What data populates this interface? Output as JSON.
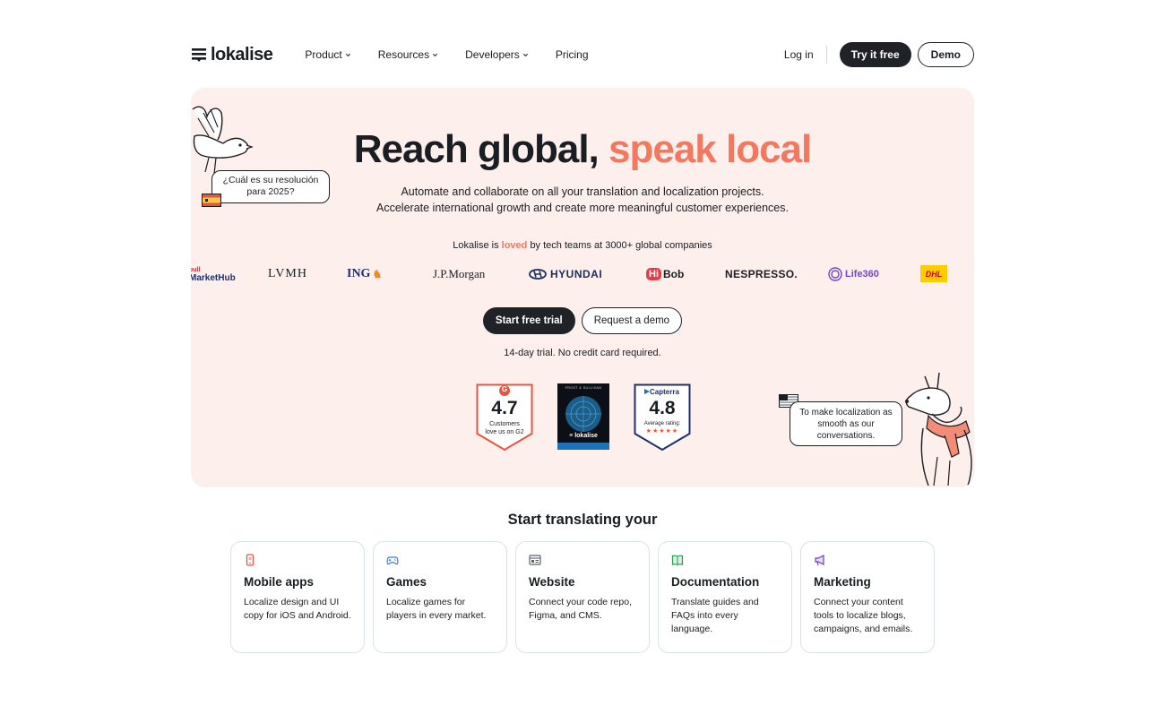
{
  "header": {
    "logo_text": "lokalise",
    "nav": [
      {
        "label": "Product",
        "has_dropdown": true
      },
      {
        "label": "Resources",
        "has_dropdown": true
      },
      {
        "label": "Developers",
        "has_dropdown": true
      },
      {
        "label": "Pricing",
        "has_dropdown": false
      }
    ],
    "login_label": "Log in",
    "try_label": "Try it free",
    "demo_label": "Demo"
  },
  "hero": {
    "title_main": "Reach global,",
    "title_accent": "speak local",
    "subtitle_line1": "Automate and collaborate on all your translation and localization projects.",
    "subtitle_line2": "Accelerate international growth and create more meaningful customer experiences.",
    "loved_prefix": "Lokalise is",
    "loved_word": "loved",
    "loved_suffix": "by tech teams at 3000+ global companies",
    "brands": {
      "marketHub": "MarketHub",
      "marketHub_top": "bull",
      "lvmh": "LVMH",
      "ing": "ING",
      "jpmorgan": "J.P.Morgan",
      "hyundai": "HYUNDAI",
      "hibob_hi": "Hi",
      "hibob_bob": "Bob",
      "nespresso": "NESPRESSO.",
      "life360": "Life360",
      "dhl": "DHL"
    },
    "cta_primary": "Start free trial",
    "cta_secondary": "Request a demo",
    "trial_note": "14-day trial. No credit card required.",
    "bubble_left": "¿Cuál es su resolución para 2025?",
    "bubble_right": "To make localization as smooth as our conversations."
  },
  "badges": {
    "g2": {
      "rating": "4.7",
      "caption": "Customers love us on G2",
      "letter": "G"
    },
    "frost": {
      "top": "FROST & SULLIVAN",
      "brand": "lokalise"
    },
    "capterra": {
      "brand": "Capterra",
      "rating": "4.8",
      "caption": "Average rating:",
      "stars": "★★★★★"
    }
  },
  "section": {
    "title": "Start translating your",
    "cards": [
      {
        "title": "Mobile apps",
        "desc": "Localize design and UI copy for iOS and Android.",
        "icon": "mobile-icon",
        "color": "#e8553f"
      },
      {
        "title": "Games",
        "desc": "Localize games for players in every market.",
        "icon": "gamepad-icon",
        "color": "#3d7bd9"
      },
      {
        "title": "Website",
        "desc": "Connect your code repo, Figma, and CMS.",
        "icon": "browser-icon",
        "color": "#5a6270"
      },
      {
        "title": "Documentation",
        "desc": "Translate guides and FAQs into every language.",
        "icon": "book-icon",
        "color": "#1f9d55"
      },
      {
        "title": "Marketing",
        "desc": "Connect your content tools to localize blogs, campaigns, and emails.",
        "icon": "megaphone-icon",
        "color": "#6a3fc4"
      }
    ]
  },
  "colors": {
    "accent": "#f2785f",
    "hero_bg": "#fcefec",
    "dark": "#1f2328"
  }
}
